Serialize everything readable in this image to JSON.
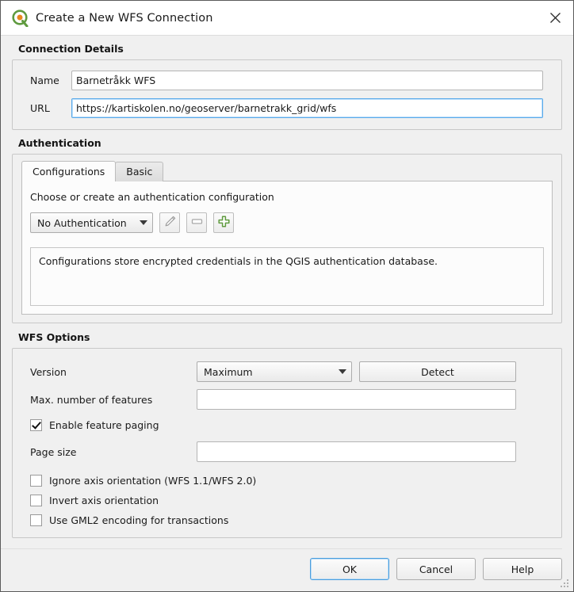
{
  "window": {
    "title": "Create a New WFS Connection",
    "logo_icon": "qgis-logo-icon",
    "close_icon": "close-icon",
    "accent_color": "#4a9ddd",
    "brand_green": "#5f9a3f",
    "brand_orange": "#e8861e"
  },
  "connection_details": {
    "group_title": "Connection Details",
    "name": {
      "label": "Name",
      "value": "Barnetråkk WFS",
      "placeholder": ""
    },
    "url": {
      "label": "URL",
      "value": "https://kartiskolen.no/geoserver/barnetrakk_grid/wfs",
      "placeholder": ""
    }
  },
  "authentication": {
    "group_title": "Authentication",
    "tabs": [
      {
        "label": "Configurations",
        "active": true
      },
      {
        "label": "Basic",
        "active": false
      }
    ],
    "hint": "Choose or create an authentication configuration",
    "config_select": {
      "value": "No Authentication",
      "arrow_icon": "chevron-down-icon"
    },
    "edit_button_icon": "pencil-icon",
    "remove_button_icon": "minus-icon",
    "add_button_icon": "plus-icon",
    "info_text": "Configurations store encrypted credentials in the QGIS authentication database."
  },
  "wfs_options": {
    "group_title": "WFS Options",
    "version": {
      "label": "Version",
      "value": "Maximum",
      "arrow_icon": "chevron-down-icon"
    },
    "detect_button": "Detect",
    "max_features": {
      "label": "Max. number of features",
      "value": "",
      "placeholder": ""
    },
    "enable_paging": {
      "label": "Enable feature paging",
      "checked": true
    },
    "page_size": {
      "label": "Page size",
      "value": "",
      "placeholder": ""
    },
    "checkboxes": [
      {
        "label": "Ignore axis orientation (WFS 1.1/WFS 2.0)",
        "checked": false
      },
      {
        "label": "Invert axis orientation",
        "checked": false
      },
      {
        "label": "Use GML2 encoding for transactions",
        "checked": false
      }
    ]
  },
  "footer": {
    "ok": "OK",
    "cancel": "Cancel",
    "help": "Help"
  }
}
